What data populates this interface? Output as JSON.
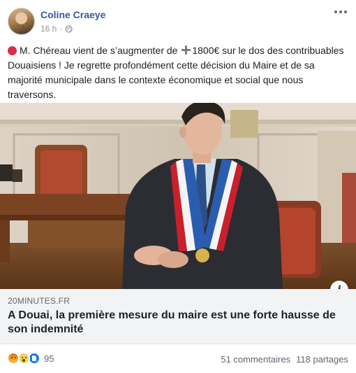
{
  "post": {
    "author": "Coline Craeye",
    "time": "16 h",
    "separator": "·",
    "audience_icon": "globe-icon",
    "more_icon": "more-options-icon",
    "text_part1": "M. Chéreau vient de s’augmenter de ",
    "text_part2": "1800€ sur le dos des contribuables Douaisiens ! Je regrette profondément cette décision du Maire et de sa majorité municipale dans le contexte économique et social que nous traversons.",
    "emoji_1": "red-circle",
    "emoji_2": "heavy-plus-sign"
  },
  "link": {
    "domain": "20MINUTES.FR",
    "headline": "A Douai, la première mesure du maire est une forte hausse de son indemnité",
    "info_label": "i"
  },
  "footer": {
    "reactions": [
      "angry",
      "wow",
      "like"
    ],
    "reaction_count": "95",
    "comments": "51 commentaires",
    "shares": "118 partages"
  },
  "colors": {
    "author_link": "#385898",
    "secondary_text": "#606770",
    "link_box_bg": "#f2f3f5",
    "like_blue": "#1877f2"
  }
}
